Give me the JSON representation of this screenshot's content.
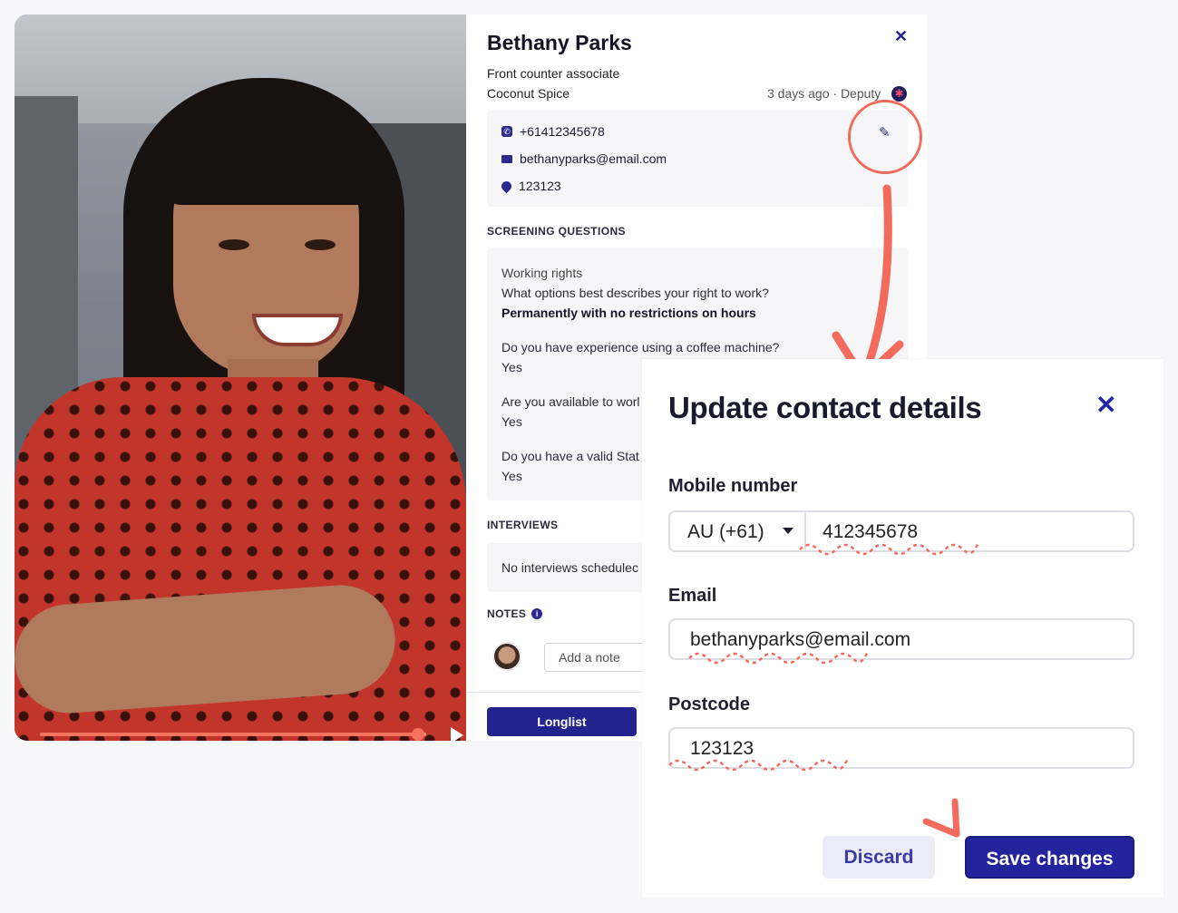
{
  "candidate": {
    "name": "Bethany Parks",
    "role": "Front counter associate",
    "company": "Coconut Spice",
    "meta": "3 days ago · Deputy",
    "phone": "+61412345678",
    "email": "bethanyparks@email.com",
    "postcode": "123123"
  },
  "video": {
    "progress": 0.98
  },
  "screening": {
    "title": "SCREENING QUESTIONS",
    "items": [
      {
        "category": "Working rights",
        "question": "What options best describes your right to work?",
        "answer": "Permanently with no restrictions on hours"
      },
      {
        "question": "Do you have experience using a coffee machine?",
        "answer": "Yes"
      },
      {
        "question": "Are you available to worl",
        "answer": "Yes"
      },
      {
        "question": "Do you have a valid Stat",
        "answer": "Yes"
      }
    ]
  },
  "interviews": {
    "title": "INTERVIEWS",
    "empty": "No interviews schedulec"
  },
  "notes": {
    "title": "NOTES",
    "placeholder": "Add a note"
  },
  "actions": {
    "longlist": "Longlist"
  },
  "modal": {
    "title": "Update contact details",
    "mobile_label": "Mobile number",
    "country": "AU (+61)",
    "mobile_value": "412345678",
    "email_label": "Email",
    "email_value": "bethanyparks@email.com",
    "postcode_label": "Postcode",
    "postcode_value": "123123",
    "discard": "Discard",
    "save": "Save changes"
  },
  "colors": {
    "accent": "#23239c",
    "annotation": "#f26b5d"
  }
}
